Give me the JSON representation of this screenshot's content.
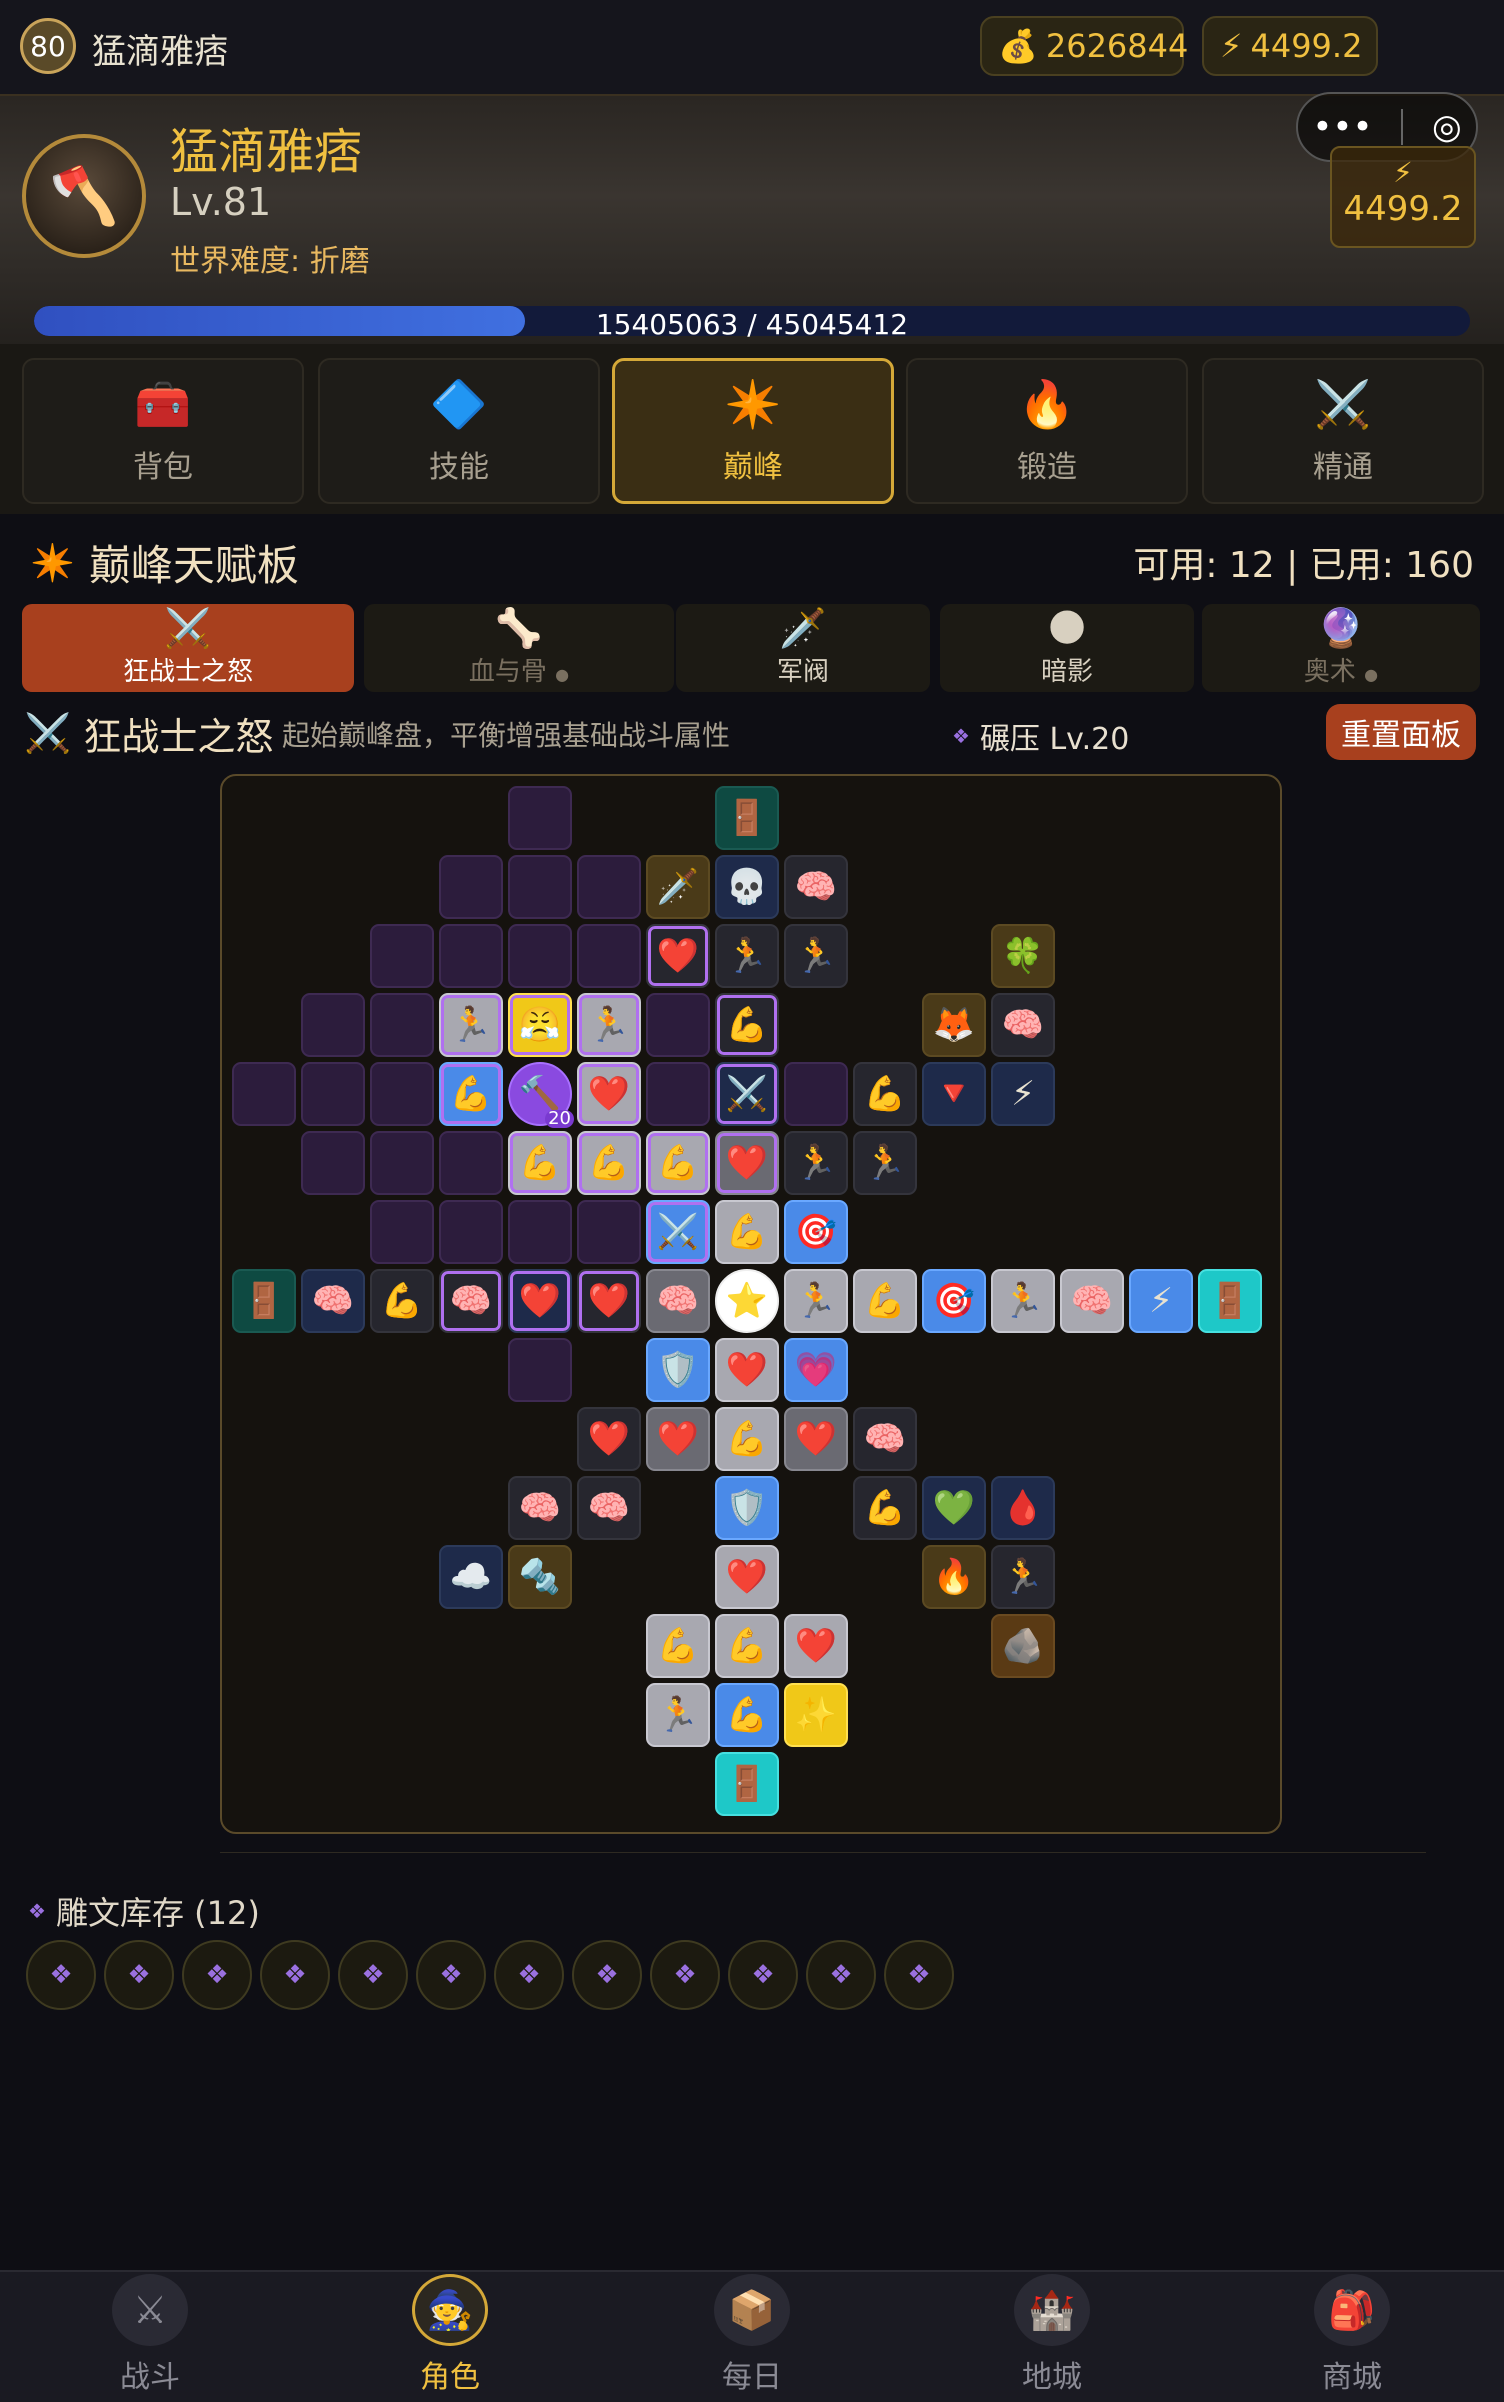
{
  "topbar": {
    "level": "80",
    "name": "猛滴雅痞",
    "gold": "2626844",
    "energy": "4499.2"
  },
  "hero": {
    "name": "猛滴雅痞",
    "level": "Lv.81",
    "difficulty": "世界难度: 折磨",
    "energy": "4499.2",
    "xp_text": "15405063 / 45045412",
    "xp_fraction": 0.342
  },
  "capsule": {
    "more": "•••",
    "target": "◎"
  },
  "nav": [
    {
      "label": "背包",
      "icon": "backpack-icon"
    },
    {
      "label": "技能",
      "icon": "skill-rune-icon"
    },
    {
      "label": "巅峰",
      "icon": "paragon-star-icon"
    },
    {
      "label": "锻造",
      "icon": "forge-icon"
    },
    {
      "label": "精通",
      "icon": "crossed-swords-icon"
    }
  ],
  "paragon": {
    "title": "巅峰天赋板",
    "stats": "可用: 12 | 已用: 160"
  },
  "subtabs": [
    {
      "label": "狂战士之怒",
      "icon": "⚔️"
    },
    {
      "label": "血与骨",
      "icon": "🦴"
    },
    {
      "label": "军阀",
      "icon": "🗡️"
    },
    {
      "label": "暗影",
      "icon": "🌑"
    },
    {
      "label": "奥术",
      "icon": "🔮"
    }
  ],
  "board_info": {
    "title": "狂战士之怒",
    "desc": "起始巅峰盘，平衡增强基础战斗属性",
    "glyph": "碾压 Lv.20",
    "reset": "重置面板"
  },
  "board_cells": [
    {
      "r": 0,
      "c": 4,
      "t": "empty"
    },
    {
      "r": 0,
      "c": 7,
      "t": "teal",
      "g": "🚪"
    },
    {
      "r": 1,
      "c": 3,
      "t": "empty"
    },
    {
      "r": 1,
      "c": 4,
      "t": "empty"
    },
    {
      "r": 1,
      "c": 5,
      "t": "empty"
    },
    {
      "r": 1,
      "c": 6,
      "t": "olive",
      "g": "🗡️"
    },
    {
      "r": 1,
      "c": 7,
      "t": "navy",
      "g": "💀"
    },
    {
      "r": 1,
      "c": 8,
      "t": "dark",
      "g": "🧠"
    },
    {
      "r": 2,
      "c": 2,
      "t": "empty"
    },
    {
      "r": 2,
      "c": 3,
      "t": "empty"
    },
    {
      "r": 2,
      "c": 4,
      "t": "empty"
    },
    {
      "r": 2,
      "c": 5,
      "t": "empty"
    },
    {
      "r": 2,
      "c": 6,
      "t": "dark",
      "g": "❤️",
      "s": 1
    },
    {
      "r": 2,
      "c": 7,
      "t": "dark",
      "g": "🏃"
    },
    {
      "r": 2,
      "c": 8,
      "t": "dark",
      "g": "🏃"
    },
    {
      "r": 2,
      "c": 11,
      "t": "olive",
      "g": "🍀"
    },
    {
      "r": 3,
      "c": 1,
      "t": "empty"
    },
    {
      "r": 3,
      "c": 2,
      "t": "empty"
    },
    {
      "r": 3,
      "c": 3,
      "t": "gray",
      "g": "🏃",
      "s": 1
    },
    {
      "r": 3,
      "c": 4,
      "t": "yellow",
      "g": "😤",
      "s": 1
    },
    {
      "r": 3,
      "c": 5,
      "t": "gray",
      "g": "🏃",
      "s": 1
    },
    {
      "r": 3,
      "c": 6,
      "t": "empty"
    },
    {
      "r": 3,
      "c": 7,
      "t": "dark",
      "g": "💪",
      "s": 1
    },
    {
      "r": 3,
      "c": 10,
      "t": "olive",
      "g": "🦊"
    },
    {
      "r": 3,
      "c": 11,
      "t": "dark",
      "g": "🧠"
    },
    {
      "r": 4,
      "c": 0,
      "t": "empty"
    },
    {
      "r": 4,
      "c": 1,
      "t": "empty"
    },
    {
      "r": 4,
      "c": 2,
      "t": "empty"
    },
    {
      "r": 4,
      "c": 3,
      "t": "blue",
      "g": "💪",
      "s": 1
    },
    {
      "r": 4,
      "c": 4,
      "t": "purple",
      "g": "🔨",
      "b": "20"
    },
    {
      "r": 4,
      "c": 5,
      "t": "gray",
      "g": "❤️",
      "s": 1
    },
    {
      "r": 4,
      "c": 6,
      "t": "empty"
    },
    {
      "r": 4,
      "c": 7,
      "t": "navy",
      "g": "⚔️",
      "s": 1
    },
    {
      "r": 4,
      "c": 8,
      "t": "empty"
    },
    {
      "r": 4,
      "c": 9,
      "t": "dark",
      "g": "💪"
    },
    {
      "r": 4,
      "c": 10,
      "t": "navy",
      "g": "🔻"
    },
    {
      "r": 4,
      "c": 11,
      "t": "navy",
      "g": "⚡"
    },
    {
      "r": 5,
      "c": 1,
      "t": "empty"
    },
    {
      "r": 5,
      "c": 2,
      "t": "empty"
    },
    {
      "r": 5,
      "c": 3,
      "t": "empty"
    },
    {
      "r": 5,
      "c": 4,
      "t": "gray",
      "g": "💪",
      "s": 1
    },
    {
      "r": 5,
      "c": 5,
      "t": "gray",
      "g": "💪",
      "s": 1
    },
    {
      "r": 5,
      "c": 6,
      "t": "gray",
      "g": "💪",
      "s": 1
    },
    {
      "r": 5,
      "c": 7,
      "t": "grayd",
      "g": "❤️",
      "s": 1
    },
    {
      "r": 5,
      "c": 8,
      "t": "dark",
      "g": "🏃"
    },
    {
      "r": 5,
      "c": 9,
      "t": "dark",
      "g": "🏃"
    },
    {
      "r": 6,
      "c": 2,
      "t": "empty"
    },
    {
      "r": 6,
      "c": 3,
      "t": "empty"
    },
    {
      "r": 6,
      "c": 4,
      "t": "empty"
    },
    {
      "r": 6,
      "c": 5,
      "t": "empty"
    },
    {
      "r": 6,
      "c": 6,
      "t": "blue",
      "g": "⚔️",
      "s": 1
    },
    {
      "r": 6,
      "c": 7,
      "t": "gray",
      "g": "💪"
    },
    {
      "r": 6,
      "c": 8,
      "t": "blue",
      "g": "🎯"
    },
    {
      "r": 7,
      "c": 0,
      "t": "teal",
      "g": "🚪"
    },
    {
      "r": 7,
      "c": 1,
      "t": "navy",
      "g": "🧠"
    },
    {
      "r": 7,
      "c": 2,
      "t": "dark",
      "g": "💪"
    },
    {
      "r": 7,
      "c": 3,
      "t": "dark",
      "g": "🧠",
      "s": 1
    },
    {
      "r": 7,
      "c": 4,
      "t": "navy",
      "g": "❤️",
      "s": 1
    },
    {
      "r": 7,
      "c": 5,
      "t": "dark",
      "g": "❤️",
      "s": 1
    },
    {
      "r": 7,
      "c": 6,
      "t": "grayd",
      "g": "🧠"
    },
    {
      "r": 7,
      "c": 7,
      "t": "white",
      "g": "⭐"
    },
    {
      "r": 7,
      "c": 8,
      "t": "gray",
      "g": "🏃"
    },
    {
      "r": 7,
      "c": 9,
      "t": "gray",
      "g": "💪"
    },
    {
      "r": 7,
      "c": 10,
      "t": "blue",
      "g": "🎯"
    },
    {
      "r": 7,
      "c": 11,
      "t": "gray",
      "g": "🏃"
    },
    {
      "r": 7,
      "c": 12,
      "t": "gray",
      "g": "🧠"
    },
    {
      "r": 7,
      "c": 13,
      "t": "blue",
      "g": "⚡"
    },
    {
      "r": 7,
      "c": 14,
      "t": "cyan",
      "g": "🚪"
    },
    {
      "r": 8,
      "c": 4,
      "t": "empty"
    },
    {
      "r": 8,
      "c": 6,
      "t": "blue",
      "g": "🛡️"
    },
    {
      "r": 8,
      "c": 7,
      "t": "gray",
      "g": "❤️"
    },
    {
      "r": 8,
      "c": 8,
      "t": "blue",
      "g": "💗"
    },
    {
      "r": 9,
      "c": 5,
      "t": "dark",
      "g": "❤️"
    },
    {
      "r": 9,
      "c": 6,
      "t": "grayd",
      "g": "❤️"
    },
    {
      "r": 9,
      "c": 7,
      "t": "gray",
      "g": "💪"
    },
    {
      "r": 9,
      "c": 8,
      "t": "grayd",
      "g": "❤️"
    },
    {
      "r": 9,
      "c": 9,
      "t": "dark",
      "g": "🧠"
    },
    {
      "r": 10,
      "c": 4,
      "t": "dark",
      "g": "🧠"
    },
    {
      "r": 10,
      "c": 5,
      "t": "dark",
      "g": "🧠"
    },
    {
      "r": 10,
      "c": 7,
      "t": "blue",
      "g": "🛡️"
    },
    {
      "r": 10,
      "c": 9,
      "t": "dark",
      "g": "💪"
    },
    {
      "r": 10,
      "c": 10,
      "t": "navy",
      "g": "💚"
    },
    {
      "r": 10,
      "c": 11,
      "t": "navy",
      "g": "🩸"
    },
    {
      "r": 11,
      "c": 3,
      "t": "navy",
      "g": "☁️"
    },
    {
      "r": 11,
      "c": 4,
      "t": "olive",
      "g": "🔩"
    },
    {
      "r": 11,
      "c": 7,
      "t": "gray",
      "g": "❤️"
    },
    {
      "r": 11,
      "c": 10,
      "t": "olive",
      "g": "🔥"
    },
    {
      "r": 11,
      "c": 11,
      "t": "dark",
      "g": "🏃"
    },
    {
      "r": 12,
      "c": 6,
      "t": "gray",
      "g": "💪"
    },
    {
      "r": 12,
      "c": 7,
      "t": "gray",
      "g": "💪"
    },
    {
      "r": 12,
      "c": 8,
      "t": "gray",
      "g": "❤️"
    },
    {
      "r": 12,
      "c": 11,
      "t": "brown",
      "g": "🪨"
    },
    {
      "r": 13,
      "c": 6,
      "t": "gray",
      "g": "🏃"
    },
    {
      "r": 13,
      "c": 7,
      "t": "blue",
      "g": "💪"
    },
    {
      "r": 13,
      "c": 8,
      "t": "yellow",
      "g": "✨"
    },
    {
      "r": 14,
      "c": 7,
      "t": "cyan",
      "g": "🚪"
    }
  ],
  "rune_storage": {
    "title": "雕文库存 (12)",
    "count": 12,
    "rune_glyph": "❖"
  },
  "bottom_nav": [
    {
      "label": "战斗",
      "icon": "⚔"
    },
    {
      "label": "角色",
      "icon": "🧙"
    },
    {
      "label": "每日",
      "icon": "📦"
    },
    {
      "label": "地城",
      "icon": "🏰"
    },
    {
      "label": "商城",
      "icon": "🎒"
    }
  ],
  "colors": {
    "gold": "#f0c040",
    "accent": "#a8401e",
    "select": "#b070f0"
  }
}
